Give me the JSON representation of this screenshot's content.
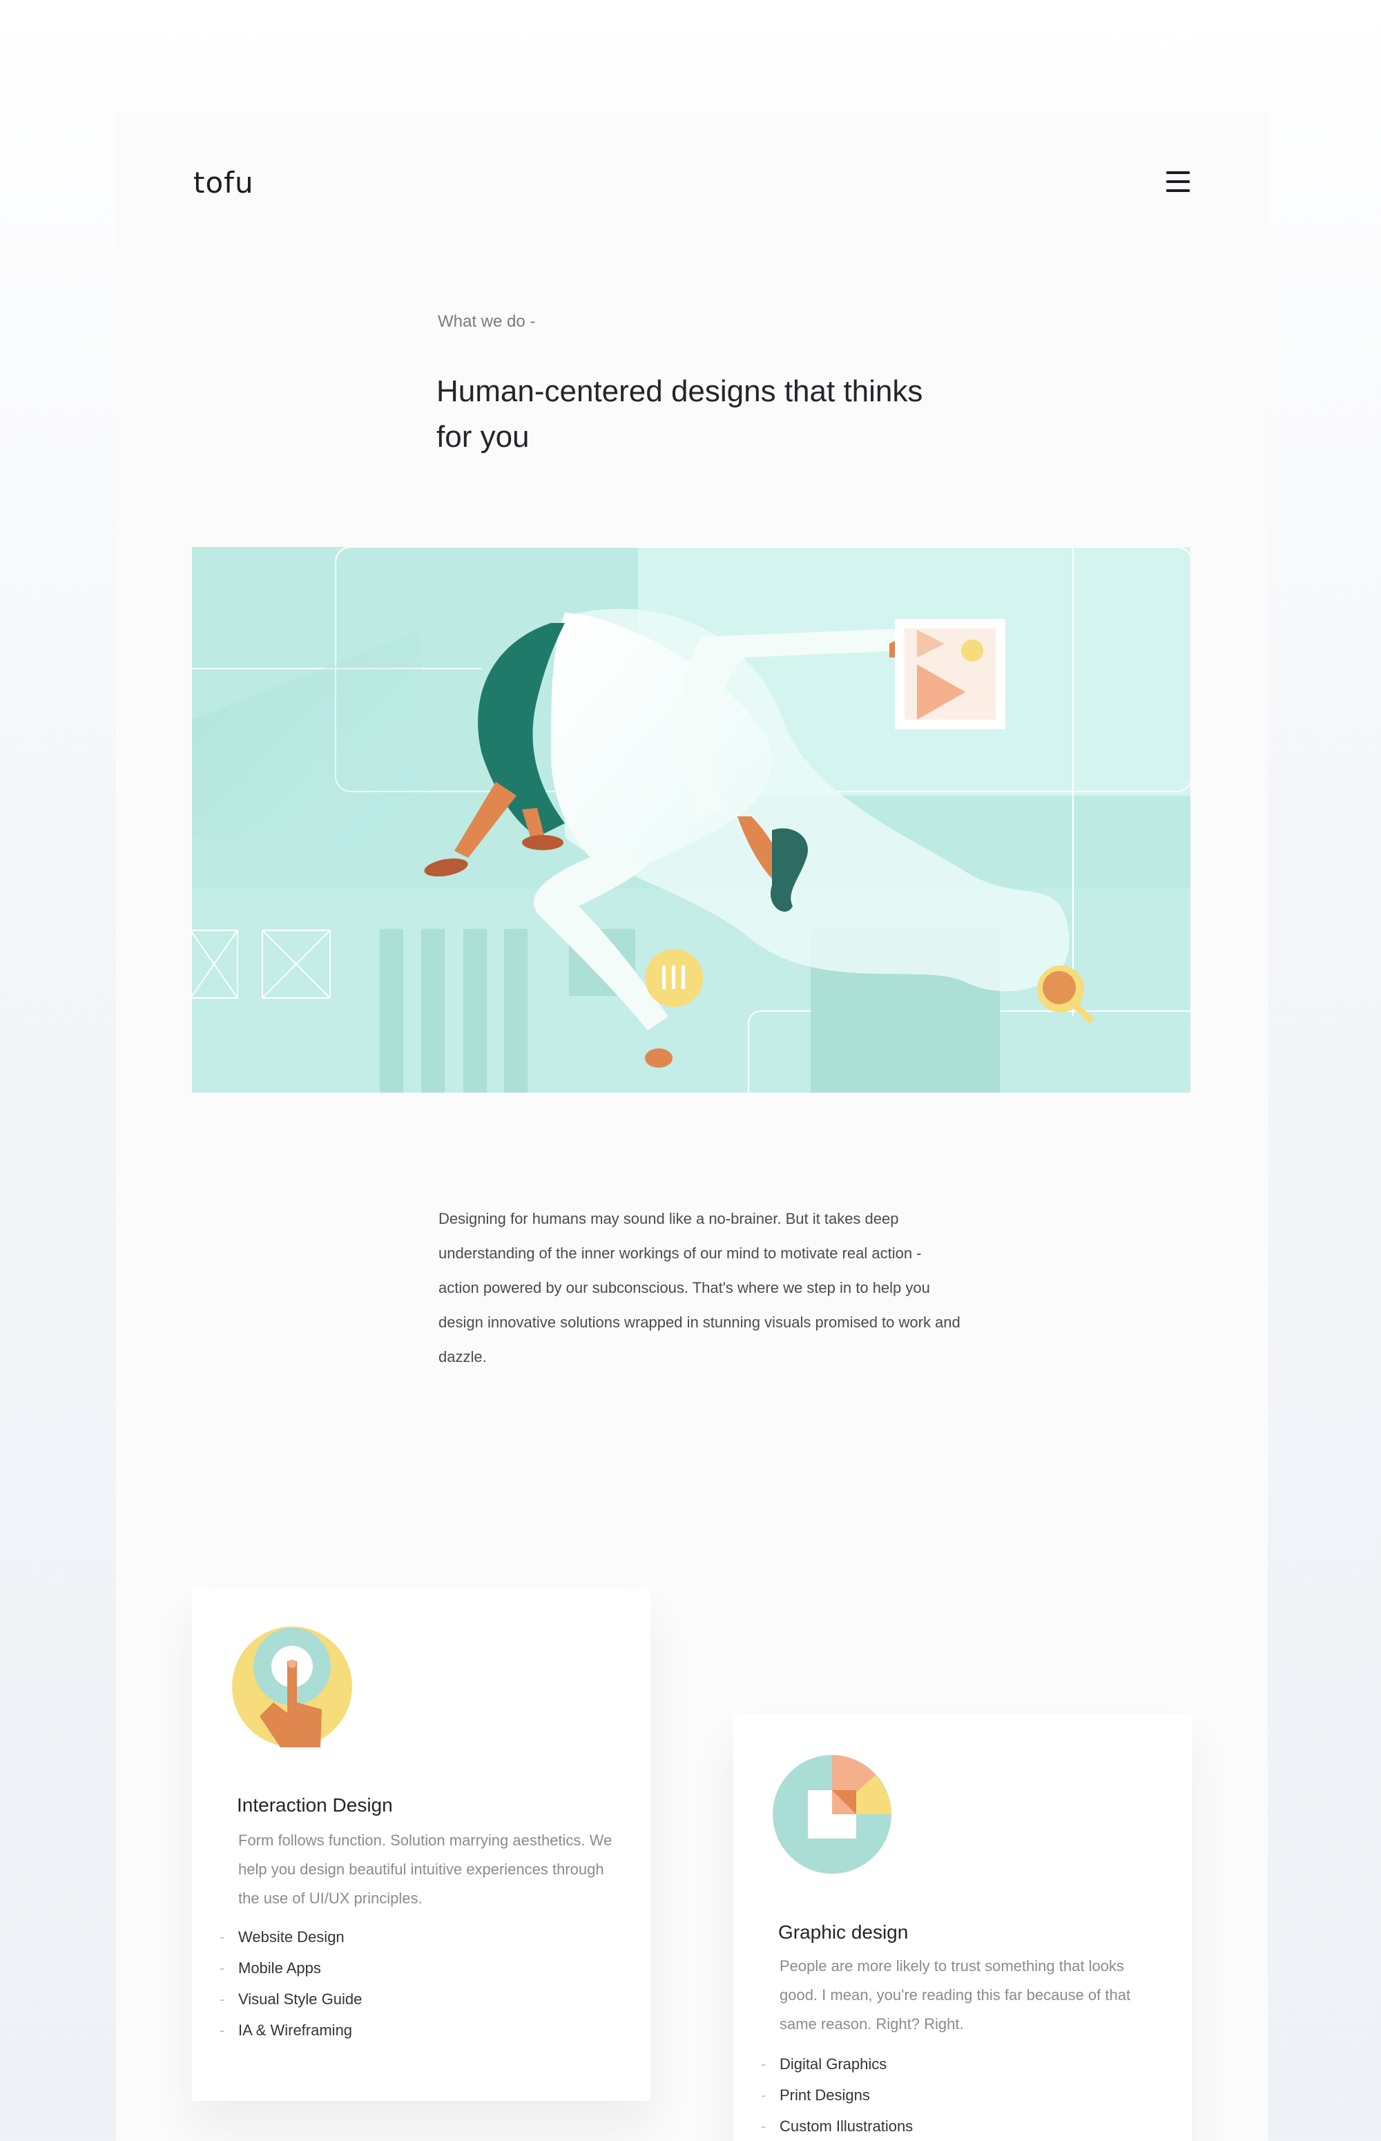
{
  "header": {
    "logo": "tofu",
    "menu_icon": "hamburger-menu-icon"
  },
  "intro": {
    "eyebrow": "What we do -",
    "headline": "Human-centered designs that thinks for you"
  },
  "hero": {
    "illustration": "person-in-white-coat-floating-over-wireframe-ui",
    "colors": {
      "background": "#bdebe4",
      "green": "#1f7a6a",
      "orange": "#e0864f",
      "yellow": "#f6dc7a"
    }
  },
  "body": {
    "text": "Designing for humans may sound like a no-brainer. But it takes deep understanding of the inner workings of our mind to motivate real action - action powered by our subconscious. That's where we step in to help you design innovative solutions wrapped in stunning visuals promised to work and dazzle."
  },
  "services": [
    {
      "icon": "touch-finger-icon",
      "title": "Interaction Design",
      "description": "Form follows function. Solution marrying aesthetics. We help you design beautiful intuitive experiences through the use of UI/UX principles.",
      "items": [
        "Website Design",
        "Mobile Apps",
        "Visual Style Guide",
        "IA & Wireframing"
      ]
    },
    {
      "icon": "pie-chart-icon",
      "title": "Graphic design",
      "description": "People are more likely to trust something that looks good. I mean, you're reading this far because of that same reason. Right? Right.",
      "items": [
        "Digital Graphics",
        "Print Designs",
        "Custom Illustrations"
      ]
    }
  ]
}
